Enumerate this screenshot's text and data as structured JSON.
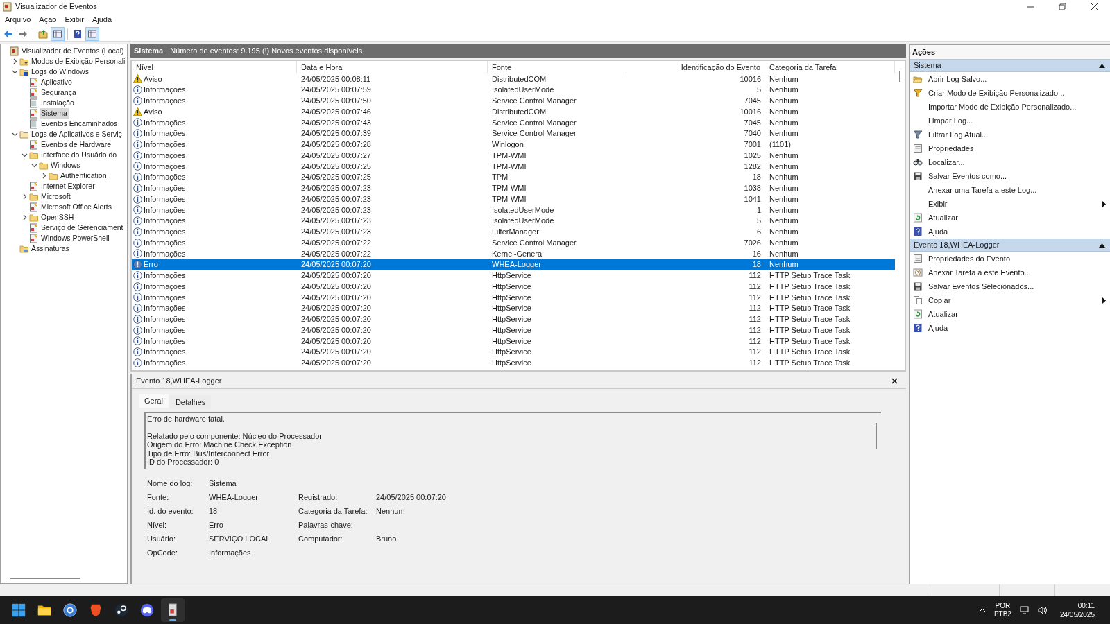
{
  "window": {
    "title": "Visualizador de Eventos"
  },
  "menu": [
    "Arquivo",
    "Ação",
    "Exibir",
    "Ajuda"
  ],
  "toolbar": [
    {
      "kind": "back"
    },
    {
      "kind": "forward"
    },
    {
      "kind": "sep"
    },
    {
      "kind": "up"
    },
    {
      "kind": "pane",
      "selected": true
    },
    {
      "kind": "sep"
    },
    {
      "kind": "help"
    },
    {
      "kind": "pane",
      "selected": true
    }
  ],
  "tree": [
    {
      "label": "Visualizador de Eventos (Local)",
      "kind": "root",
      "selected": false,
      "children": [
        {
          "label": "Modos de Exibição Personali",
          "kind": "filterfolder",
          "expanded": false,
          "selected": false
        },
        {
          "label": "Logs do Windows",
          "kind": "winfolder",
          "expanded": true,
          "selected": false,
          "children": [
            {
              "label": "Aplicativo",
              "kind": "log",
              "selected": false
            },
            {
              "label": "Segurança",
              "kind": "log",
              "selected": false
            },
            {
              "label": "Instalação",
              "kind": "plainlog",
              "selected": false
            },
            {
              "label": "Sistema",
              "kind": "log",
              "selected": true
            },
            {
              "label": "Eventos Encaminhados",
              "kind": "plainlog",
              "selected": false
            }
          ]
        },
        {
          "label": "Logs de Aplicativos e Serviç",
          "kind": "appfolder",
          "expanded": true,
          "selected": false,
          "children": [
            {
              "label": "Eventos de Hardware",
              "kind": "log",
              "selected": false
            },
            {
              "label": "Interface do Usuário do",
              "kind": "folder",
              "expanded": true,
              "selected": false,
              "children": [
                {
                  "label": "Windows",
                  "kind": "folder",
                  "expanded": true,
                  "selected": false,
                  "children": [
                    {
                      "label": "Authentication",
                      "kind": "folder",
                      "expanded": false,
                      "selected": false
                    }
                  ]
                }
              ]
            },
            {
              "label": "Internet Explorer",
              "kind": "log",
              "selected": false
            },
            {
              "label": "Microsoft",
              "kind": "folder",
              "expanded": false,
              "selected": false
            },
            {
              "label": "Microsoft Office Alerts",
              "kind": "log",
              "selected": false
            },
            {
              "label": "OpenSSH",
              "kind": "folder",
              "expanded": false,
              "selected": false
            },
            {
              "label": "Serviço de Gerenciament",
              "kind": "log",
              "selected": false
            },
            {
              "label": "Windows PowerShell",
              "kind": "log",
              "selected": false
            }
          ]
        },
        {
          "label": "Assinaturas",
          "kind": "subs",
          "selected": false
        }
      ]
    }
  ],
  "log_header": {
    "title": "Sistema",
    "info": "Número de eventos: 9.195 (!) Novos eventos disponíveis"
  },
  "table": {
    "columns": [
      "Nível",
      "Data e Hora",
      "Fonte",
      "Identificação do Evento",
      "Categoria da Tarefa"
    ],
    "rows": [
      {
        "kind": "warning",
        "level": "Aviso",
        "date": "24/05/2025 00:08:11",
        "source": "DistributedCOM",
        "id": "10016",
        "category": "Nenhum",
        "selected": false
      },
      {
        "kind": "info",
        "level": "Informações",
        "date": "24/05/2025 00:07:59",
        "source": "IsolatedUserMode",
        "id": "5",
        "category": "Nenhum",
        "selected": false
      },
      {
        "kind": "info",
        "level": "Informações",
        "date": "24/05/2025 00:07:50",
        "source": "Service Control Manager",
        "id": "7045",
        "category": "Nenhum",
        "selected": false
      },
      {
        "kind": "warning",
        "level": "Aviso",
        "date": "24/05/2025 00:07:46",
        "source": "DistributedCOM",
        "id": "10016",
        "category": "Nenhum",
        "selected": false
      },
      {
        "kind": "info",
        "level": "Informações",
        "date": "24/05/2025 00:07:43",
        "source": "Service Control Manager",
        "id": "7045",
        "category": "Nenhum",
        "selected": false
      },
      {
        "kind": "info",
        "level": "Informações",
        "date": "24/05/2025 00:07:39",
        "source": "Service Control Manager",
        "id": "7040",
        "category": "Nenhum",
        "selected": false
      },
      {
        "kind": "info",
        "level": "Informações",
        "date": "24/05/2025 00:07:28",
        "source": "Winlogon",
        "id": "7001",
        "category": "(1101)",
        "selected": false
      },
      {
        "kind": "info",
        "level": "Informações",
        "date": "24/05/2025 00:07:27",
        "source": "TPM-WMI",
        "id": "1025",
        "category": "Nenhum",
        "selected": false
      },
      {
        "kind": "info",
        "level": "Informações",
        "date": "24/05/2025 00:07:25",
        "source": "TPM-WMI",
        "id": "1282",
        "category": "Nenhum",
        "selected": false
      },
      {
        "kind": "info",
        "level": "Informações",
        "date": "24/05/2025 00:07:25",
        "source": "TPM",
        "id": "18",
        "category": "Nenhum",
        "selected": false
      },
      {
        "kind": "info",
        "level": "Informações",
        "date": "24/05/2025 00:07:23",
        "source": "TPM-WMI",
        "id": "1038",
        "category": "Nenhum",
        "selected": false
      },
      {
        "kind": "info",
        "level": "Informações",
        "date": "24/05/2025 00:07:23",
        "source": "TPM-WMI",
        "id": "1041",
        "category": "Nenhum",
        "selected": false
      },
      {
        "kind": "info",
        "level": "Informações",
        "date": "24/05/2025 00:07:23",
        "source": "IsolatedUserMode",
        "id": "1",
        "category": "Nenhum",
        "selected": false
      },
      {
        "kind": "info",
        "level": "Informações",
        "date": "24/05/2025 00:07:23",
        "source": "IsolatedUserMode",
        "id": "5",
        "category": "Nenhum",
        "selected": false
      },
      {
        "kind": "info",
        "level": "Informações",
        "date": "24/05/2025 00:07:23",
        "source": "FilterManager",
        "id": "6",
        "category": "Nenhum",
        "selected": false
      },
      {
        "kind": "info",
        "level": "Informações",
        "date": "24/05/2025 00:07:22",
        "source": "Service Control Manager",
        "id": "7026",
        "category": "Nenhum",
        "selected": false
      },
      {
        "kind": "info",
        "level": "Informações",
        "date": "24/05/2025 00:07:22",
        "source": "Kernel-General",
        "id": "16",
        "category": "Nenhum",
        "selected": false
      },
      {
        "kind": "error",
        "level": "Erro",
        "date": "24/05/2025 00:07:20",
        "source": "WHEA-Logger",
        "id": "18",
        "category": "Nenhum",
        "selected": true
      },
      {
        "kind": "info",
        "level": "Informações",
        "date": "24/05/2025 00:07:20",
        "source": "HttpService",
        "id": "112",
        "category": "HTTP Setup Trace Task",
        "selected": false
      },
      {
        "kind": "info",
        "level": "Informações",
        "date": "24/05/2025 00:07:20",
        "source": "HttpService",
        "id": "112",
        "category": "HTTP Setup Trace Task",
        "selected": false
      },
      {
        "kind": "info",
        "level": "Informações",
        "date": "24/05/2025 00:07:20",
        "source": "HttpService",
        "id": "112",
        "category": "HTTP Setup Trace Task",
        "selected": false
      },
      {
        "kind": "info",
        "level": "Informações",
        "date": "24/05/2025 00:07:20",
        "source": "HttpService",
        "id": "112",
        "category": "HTTP Setup Trace Task",
        "selected": false
      },
      {
        "kind": "info",
        "level": "Informações",
        "date": "24/05/2025 00:07:20",
        "source": "HttpService",
        "id": "112",
        "category": "HTTP Setup Trace Task",
        "selected": false
      },
      {
        "kind": "info",
        "level": "Informações",
        "date": "24/05/2025 00:07:20",
        "source": "HttpService",
        "id": "112",
        "category": "HTTP Setup Trace Task",
        "selected": false
      },
      {
        "kind": "info",
        "level": "Informações",
        "date": "24/05/2025 00:07:20",
        "source": "HttpService",
        "id": "112",
        "category": "HTTP Setup Trace Task",
        "selected": false
      },
      {
        "kind": "info",
        "level": "Informações",
        "date": "24/05/2025 00:07:20",
        "source": "HttpService",
        "id": "112",
        "category": "HTTP Setup Trace Task",
        "selected": false
      },
      {
        "kind": "info",
        "level": "Informações",
        "date": "24/05/2025 00:07:20",
        "source": "HttpService",
        "id": "112",
        "category": "HTTP Setup Trace Task",
        "selected": false
      }
    ]
  },
  "detail": {
    "title": "Evento 18,WHEA-Logger",
    "tabs": [
      {
        "label": "Geral",
        "selected": true
      },
      {
        "label": "Detalhes",
        "selected": false
      }
    ],
    "summary": "Erro de hardware fatal.",
    "description": [
      "Relatado pelo componente: Núcleo do Processador",
      "Origem do Erro: Machine Check Exception",
      "Tipo de Erro: Bus/Interconnect Error",
      "ID do Processador: 0"
    ],
    "fields": [
      [
        {
          "label": "Nome do log:",
          "value": "Sistema"
        }
      ],
      [
        {
          "label": "Fonte:",
          "value": "WHEA-Logger"
        },
        {
          "label": "Registrado:",
          "value": "24/05/2025 00:07:20"
        }
      ],
      [
        {
          "label": "Id. do evento:",
          "value": "18"
        },
        {
          "label": "Categoria da Tarefa:",
          "value": "Nenhum"
        }
      ],
      [
        {
          "label": "Nível:",
          "value": "Erro"
        },
        {
          "label": "Palavras-chave:"
        }
      ],
      [
        {
          "label": "Usuário:",
          "value": "SERVIÇO LOCAL"
        },
        {
          "label": "Computador:",
          "value": "Bruno"
        }
      ],
      [
        {
          "label": "OpCode:",
          "value": "Informações"
        }
      ]
    ]
  },
  "actions": {
    "title": "Ações",
    "sections": [
      {
        "title": "Sistema",
        "expanded": true,
        "items": [
          {
            "label": "Abrir Log Salvo...",
            "kind": "open"
          },
          {
            "label": "Criar Modo de Exibição Personalizado...",
            "kind": "filtercolor"
          },
          {
            "label": "Importar Modo de Exibição Personalizado...",
            "kind": "plain"
          },
          {
            "label": "Limpar Log...",
            "kind": "plain"
          },
          {
            "label": "Filtrar Log Atual...",
            "kind": "filter"
          },
          {
            "label": "Propriedades",
            "kind": "props"
          },
          {
            "label": "Localizar...",
            "kind": "find"
          },
          {
            "label": "Salvar Eventos como...",
            "kind": "save"
          },
          {
            "label": "Anexar uma Tarefa a este Log...",
            "kind": "plain"
          },
          {
            "label": "Exibir",
            "kind": "plain",
            "submenu": true
          },
          {
            "label": "Atualizar",
            "kind": "refresh"
          },
          {
            "label": "Ajuda",
            "kind": "help"
          }
        ]
      },
      {
        "title": "Evento 18,WHEA-Logger",
        "expanded": true,
        "items": [
          {
            "label": "Propriedades do Evento",
            "kind": "props"
          },
          {
            "label": "Anexar Tarefa a este Evento...",
            "kind": "task"
          },
          {
            "label": "Salvar Eventos Selecionados...",
            "kind": "save"
          },
          {
            "label": "Copiar",
            "kind": "copy",
            "submenu": true
          },
          {
            "label": "Atualizar",
            "kind": "refresh"
          },
          {
            "label": "Ajuda",
            "kind": "help"
          }
        ]
      }
    ]
  },
  "taskbar": {
    "apps": [
      {
        "kind": "start",
        "selected": false
      },
      {
        "kind": "folder",
        "selected": false
      },
      {
        "kind": "qb",
        "selected": false
      },
      {
        "kind": "brave",
        "selected": false
      },
      {
        "kind": "steam",
        "selected": false
      },
      {
        "kind": "discord",
        "selected": false
      },
      {
        "kind": "eventviewer",
        "selected": true
      }
    ],
    "language": [
      "POR",
      "PTB2"
    ],
    "time": "00:11",
    "date": "24/05/2025"
  }
}
